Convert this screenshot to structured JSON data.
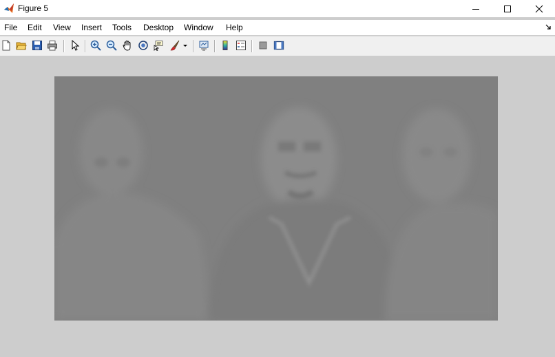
{
  "window": {
    "title": "Figure 5",
    "controls": [
      "minimize-icon",
      "maximize-icon",
      "close-icon"
    ]
  },
  "menu": {
    "items": [
      {
        "label": "File"
      },
      {
        "label": "Edit"
      },
      {
        "label": "View"
      },
      {
        "label": "Insert"
      },
      {
        "label": "Tools"
      },
      {
        "label": "Desktop"
      },
      {
        "label": "Window"
      },
      {
        "label": "Help"
      }
    ]
  },
  "toolbar": {
    "icons": [
      "new-figure-icon",
      "open-file-icon",
      "save-icon",
      "print-icon",
      "edit-plot-arrow-icon",
      "zoom-in-icon",
      "zoom-out-icon",
      "pan-hand-icon",
      "rotate-3d-icon",
      "data-cursor-icon",
      "brush-icon",
      "brush-dropdown-icon",
      "link-plot-icon",
      "insert-colorbar-icon",
      "insert-legend-icon",
      "hide-plot-tools-icon",
      "show-plot-tools-icon"
    ]
  },
  "colors": {
    "figure_background": "#cdcdcd",
    "image_base": "#808080",
    "menubar": "#ffffff",
    "toolbar": "#f0f0f0"
  },
  "image": {
    "description_icon": "grayscale-image-display"
  }
}
